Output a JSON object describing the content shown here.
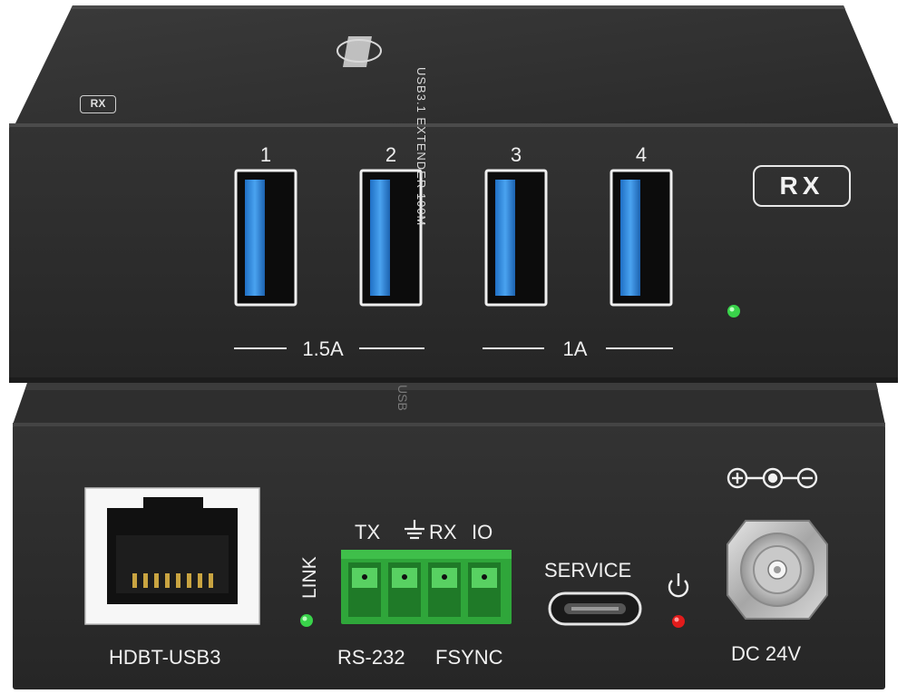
{
  "rx_unit": {
    "top_print": "USB3.1 EXTENDER 100M",
    "small_badge": "RX",
    "badge": "RX",
    "ports": [
      {
        "number": "1"
      },
      {
        "number": "2"
      },
      {
        "number": "3"
      },
      {
        "number": "4"
      }
    ],
    "ratings": {
      "left": "1.5A",
      "right": "1A"
    }
  },
  "tx_unit": {
    "side_print": "USB",
    "rj45_label": "HDBT-USB3",
    "link_label": "LINK",
    "terminal_labels": {
      "tx": "TX",
      "rx": "RX",
      "io": "IO"
    },
    "rs232_label": "RS-232",
    "fsync_label": "FSYNC",
    "service_label": "SERVICE",
    "dc_label": "DC 24V"
  },
  "colors": {
    "body": "#2b2b2b",
    "usb_blue": "#2f86d6",
    "led_green": "#39d34a",
    "led_red": "#e21b1b",
    "terminal_green": "#2fa63a"
  }
}
